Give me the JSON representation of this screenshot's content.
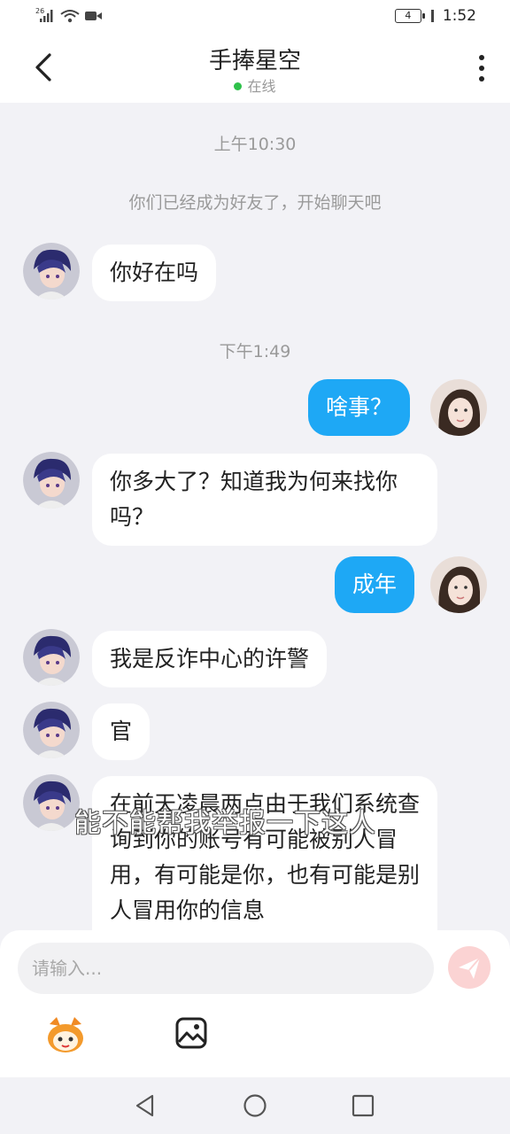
{
  "status_bar": {
    "network_label": "26",
    "battery_level": "4",
    "time": "1:52"
  },
  "header": {
    "title": "手捧星空",
    "status": "在线"
  },
  "chat": {
    "timestamp_1": "上午10:30",
    "system_message": "你们已经成为好友了，开始聊天吧",
    "timestamp_2": "下午1:49",
    "messages": [
      {
        "side": "in",
        "text": "你好在吗"
      },
      {
        "side": "out",
        "text": "啥事？"
      },
      {
        "side": "in",
        "text": "你多大了？知道我为何来找你吗？"
      },
      {
        "side": "out",
        "text": "成年"
      },
      {
        "side": "in",
        "text": "我是反诈中心的许警"
      },
      {
        "side": "in",
        "text": "官"
      },
      {
        "side": "in",
        "text": "在前天凌晨两点由于我们系统查询到你的账号有可能被别人冒用，有可能是你，也有可能是别人冒用你的信息"
      }
    ]
  },
  "overlay_caption": "能不能帮我举报一下这人",
  "composer": {
    "placeholder": "请输入..."
  },
  "colors": {
    "accent": "#1ea8f5",
    "online_dot": "#2ec14a",
    "send_disabled": "#fbd3d3"
  },
  "icons": [
    "back-icon",
    "more-icon",
    "send-icon",
    "mascot-emoji-icon",
    "image-icon",
    "nav-back-icon",
    "nav-home-icon",
    "nav-recent-icon"
  ]
}
